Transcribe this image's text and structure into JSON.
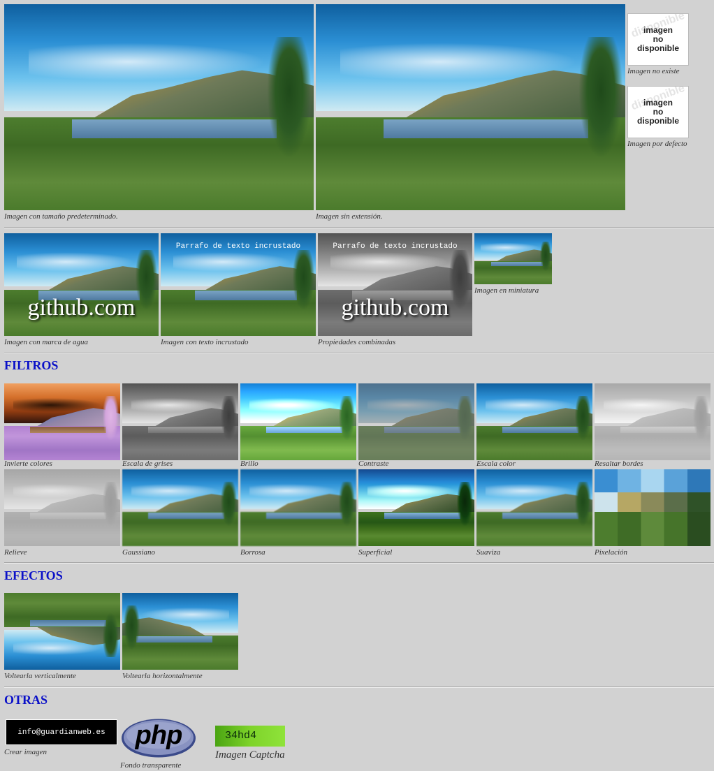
{
  "top": {
    "default_size_caption": "Imagen con tamaño predeterminado.",
    "no_extension_caption": "Imagen sin extensión.",
    "not_available_text": [
      "imagen",
      "no",
      "disponible"
    ],
    "not_exists_caption": "Imagen no existe",
    "default_image_caption": "Imagen por defecto"
  },
  "second": {
    "watermark_text": "github.com",
    "embedded_text": "Parrafo de texto incrustado",
    "watermark_caption": "Imagen con marca de agua",
    "embedded_caption": "Imagen con texto incrustado",
    "combined_caption": "Propiedades combinadas",
    "thumbnail_caption": "Imagen en miniatura"
  },
  "filtros": {
    "heading": "FILTROS",
    "row1": [
      "Invierte colores",
      "Escala de grises",
      "Brillo",
      "Contraste",
      "Escala color",
      "Resaltar bordes"
    ],
    "row2": [
      "Relieve",
      "Gaussiano",
      "Borrosa",
      "Superficial",
      "Suaviza",
      "Pixelación"
    ]
  },
  "efectos": {
    "heading": "EFECTOS",
    "items": [
      "Voltearla verticalmente",
      "Voltearla horizontalmente"
    ]
  },
  "otras": {
    "heading": "OTRAS",
    "email_image_text": "info@guardianweb.es",
    "create_caption": "Crear imagen",
    "php_logo_text": "php",
    "transparent_caption": "Fondo transparente",
    "captcha_text": "34hd4",
    "captcha_caption": "Imagen Captcha"
  },
  "colors": {
    "page_bg": "#d2d2d2",
    "heading": "#0a10c8",
    "captcha_bg": "#6ecb1e"
  }
}
